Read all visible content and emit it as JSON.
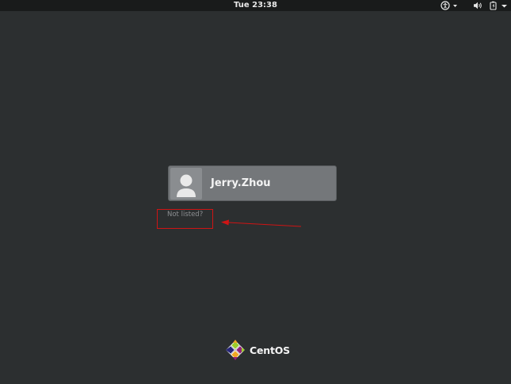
{
  "topbar": {
    "clock": "Tue 23:38",
    "icons": [
      "accessibility-icon",
      "volume-icon",
      "battery-icon"
    ]
  },
  "login": {
    "user_name": "Jerry.Zhou",
    "not_listed_label": "Not listed?"
  },
  "brand": {
    "name": "CentOS"
  },
  "colors": {
    "background": "#2c2f30",
    "topbar": "#191b1b",
    "user_card": "#74777a",
    "annotation_red": "#cf1414"
  }
}
